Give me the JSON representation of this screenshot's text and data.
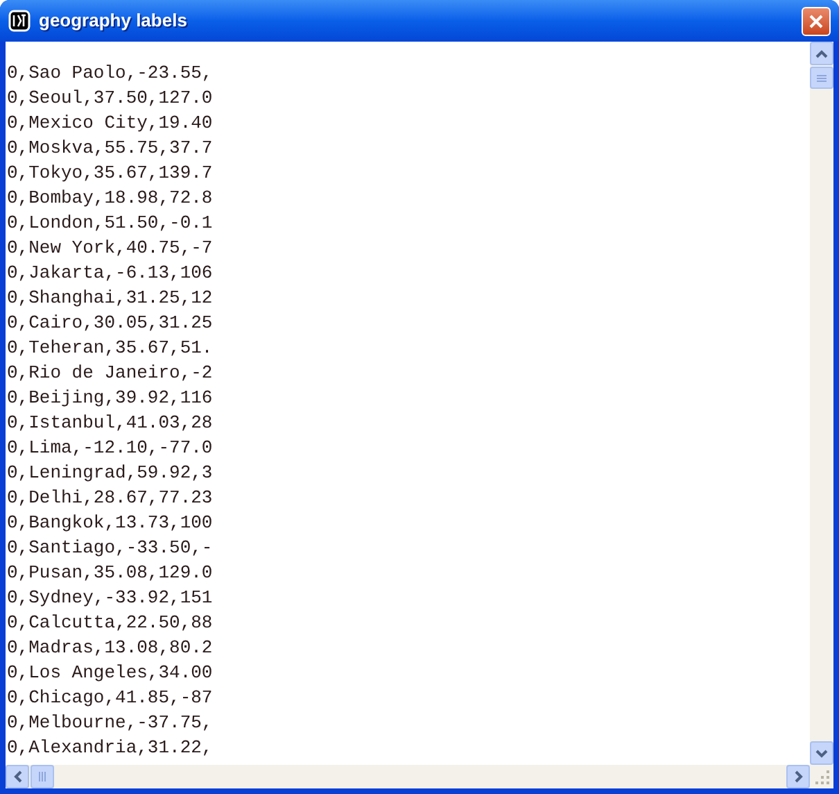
{
  "window": {
    "title": "geography labels"
  },
  "lines": [
    "0,Sao Paolo,-23.55,",
    "0,Seoul,37.50,127.0",
    "0,Mexico City,19.40",
    "0,Moskva,55.75,37.7",
    "0,Tokyo,35.67,139.7",
    "0,Bombay,18.98,72.8",
    "0,London,51.50,-0.1",
    "0,New York,40.75,-7",
    "0,Jakarta,-6.13,106",
    "0,Shanghai,31.25,12",
    "0,Cairo,30.05,31.25",
    "0,Teheran,35.67,51.",
    "0,Rio de Janeiro,-2",
    "0,Beijing,39.92,116",
    "0,Istanbul,41.03,28",
    "0,Lima,-12.10,-77.0",
    "0,Leningrad,59.92,3",
    "0,Delhi,28.67,77.23",
    "0,Bangkok,13.73,100",
    "0,Santiago,-33.50,-",
    "0,Pusan,35.08,129.0",
    "0,Sydney,-33.92,151",
    "0,Calcutta,22.50,88",
    "0,Madras,13.08,80.2",
    "0,Los Angeles,34.00",
    "0,Chicago,41.85,-87",
    "0,Melbourne,-37.75,",
    "0,Alexandria,31.22,"
  ]
}
